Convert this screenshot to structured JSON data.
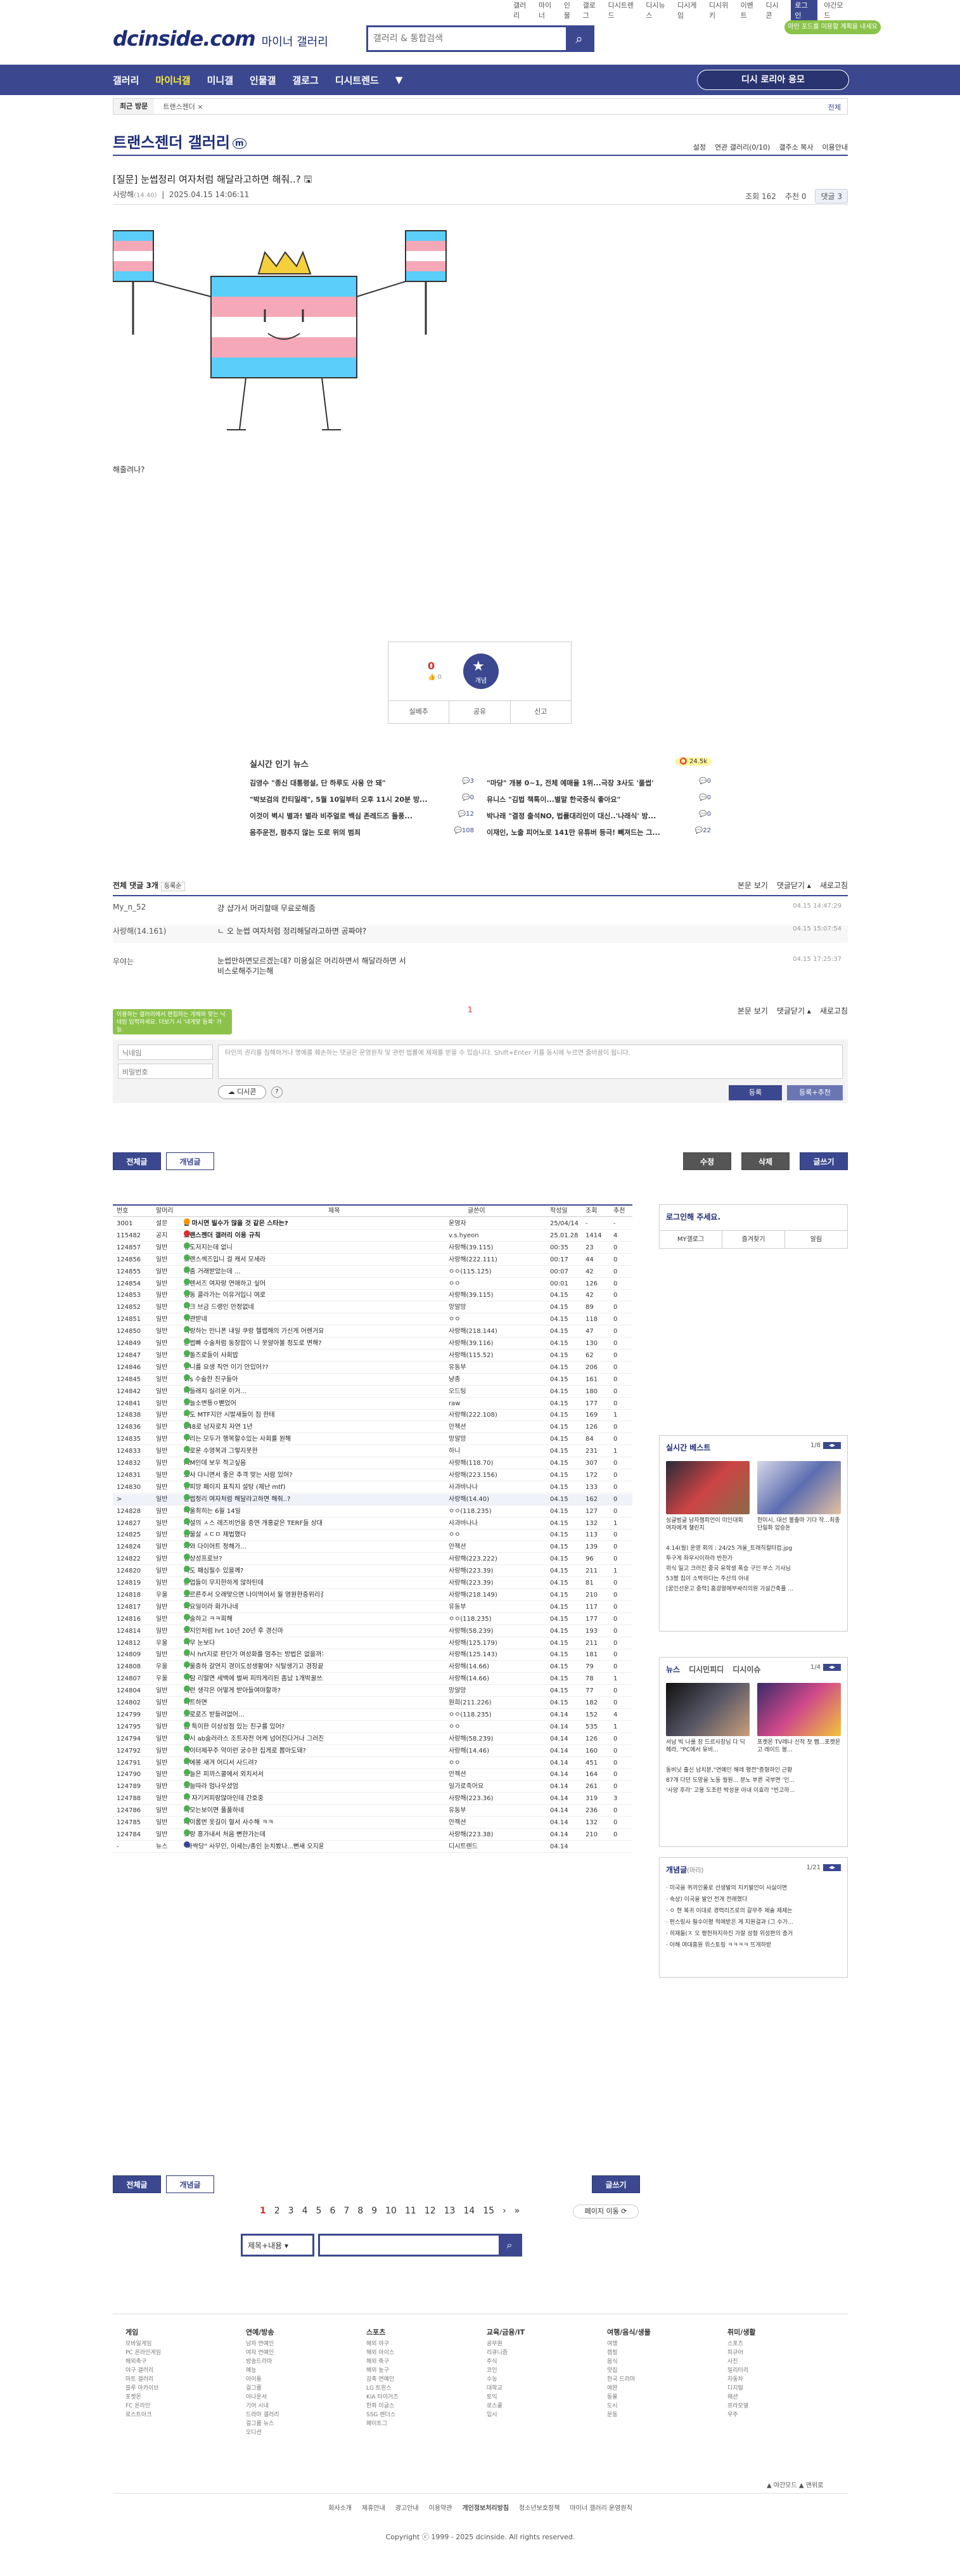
{
  "util": [
    "갤러리",
    "마이너",
    "인물",
    "갤로그",
    "디시트렌드",
    "디시뉴스",
    "디시게임",
    "디시위키",
    "이벤트",
    "디시콘",
    "로그인",
    "야간모드"
  ],
  "logo": {
    "text": "dcinside.com",
    "sub": "마이너 갤러리"
  },
  "search": {
    "placeholder": "갤러리 & 통합검색"
  },
  "promo": "마인 포드를 미용할 계획을 내세요",
  "gnb": {
    "items": [
      "갤러리",
      "마이너갤",
      "미니갤",
      "인물갤",
      "갤로그",
      "디시트렌드",
      "▼"
    ],
    "cta": "디시 로리아 응모"
  },
  "recent": {
    "label": "최근 방문",
    "item": "트랜스젠더 ×",
    "edit": "전체"
  },
  "gallery": {
    "title": "트랜스젠더 갤러리",
    "mark": "m",
    "tools": [
      "설정",
      "연관 갤러리(0/10)",
      "갤주소 복사",
      "이용안내"
    ]
  },
  "post": {
    "title": "[질문] 눈썹정리 여자처럼 해달라고하면 해줘..? 🖫",
    "author": "사랑해",
    "ip": "(14.40)",
    "date": "2025.04.15 14:06:11",
    "views": "조회 162",
    "rec": "추천 0",
    "comments": "댓글 3",
    "body": "해줄려나?"
  },
  "recommend": {
    "up": "0",
    "upsub": "0",
    "label": "개념",
    "actions": [
      "실베추",
      "공유",
      "신고"
    ]
  },
  "news": {
    "title": "실시간 인기 뉴스",
    "badge": "24.5k",
    "rows": [
      [
        "김영수 \"종신 대통령설, 단 하루도 사용 안 돼\"",
        "3",
        "\"마당\" 개봉 0~1, 전체 예매율 1위...극장 3사도 '풀썹'",
        "0"
      ],
      [
        "\"박보검의 칸티일레\", 5월 10일부터 오후 11시 20분 방...",
        "0",
        "유니스 \"김법 책톡이...별말 한국중식 좋아요\"",
        "0"
      ],
      [
        "이것이 벽시 별과! 별라 비주얼로 백심 존레드즈 돌풍...",
        "12",
        "박나래 \"결정 출석NO, 법률대리인이 대신..'나래식' 방...",
        "0"
      ],
      [
        "음주운전, 팜추지 않는 도로 위의 범죄",
        "108",
        "이재인, 노출 피어노로 141만 유튜버 등극! 빼져드는 그...",
        "22"
      ]
    ]
  },
  "comments": {
    "total": "전체 댓글 3개",
    "sort": "등록순",
    "actions": [
      "본문 보기",
      "댓글닫기 ▴",
      "새로고침"
    ],
    "rows": [
      {
        "name": "My_n_52",
        "text": "걍 샵가서 머리할때 무료로해줌",
        "date": "04.15 14:47:29"
      },
      {
        "name": "사랑해(14.161)",
        "text": "ㄴ 오 눈썹 여자처럼 정리해달라고하면 공짜야?",
        "date": "04.15 15:07:54"
      },
      {
        "name": "우야는",
        "text": "눈썹만하면모르겠는데? 미용실은 머리하면서 해달라하면 서비스로해주기는해",
        "date": "04.15 17:25:37"
      }
    ],
    "page": "1",
    "tip": "이용하는 갤러리에서 편집하는 개체와 맞는 닉네임 입력하세요. 더보기 시 '내게맞 등록' 가능.",
    "name_ph": "닉네임",
    "pw_ph": "비밀번호",
    "textarea": "타인의 권리를 침해하거나 명예를 훼손하는 댓글은 운영원칙 및 관련 법률에 제재를 받을 수 있습니다. Shift+Enter 키를 동시에 누르면 줄바꿈이 됩니다.",
    "dccon": "디시콘",
    "help": "?",
    "submit": "등록",
    "submit2": "등록+추천"
  },
  "buttons": {
    "all": "전체글",
    "concept": "개념글",
    "edit": "수정",
    "del": "삭제",
    "write": "글쓰기"
  },
  "list": {
    "headers": [
      "번호",
      "말머리",
      "제목",
      "글쓴이",
      "작성일",
      "조회",
      "추천"
    ],
    "rows": [
      [
        "3001",
        "설문",
        "울 마시면 빌수가 많을 것 같은 스타는?",
        "운영자",
        "25/04/14",
        "-",
        "-"
      ],
      [
        "115482",
        "공지",
        "트랜스젠더 갤러리 이용 규칙",
        "v.s.hyeon",
        "25.01.28",
        "1414",
        "4"
      ],
      [
        "124857",
        "일반",
        "유도저지는데 없니",
        "사랑해(39.115)",
        "00:35",
        "23",
        "0"
      ],
      [
        "124856",
        "일반",
        "트랜스섹즈입니 걸 캐서 모세라",
        "사랑해(222.111)",
        "00:17",
        "44",
        "0"
      ],
      [
        "124855",
        "일반",
        "아줌 거래받았는데 ...",
        "ㅇㅇ(115.125)",
        "00:07",
        "42",
        "0"
      ],
      [
        "124854",
        "일반",
        "트렌서즈 여자랑 연애하고 싶어",
        "ㅇㅇ",
        "00:01",
        "126",
        "0"
      ],
      [
        "124853",
        "일반",
        "냉동 콜라가는 이유거입니 여로",
        "사랑해(39.115)",
        "04.15",
        "42",
        "0"
      ],
      [
        "124852",
        "일반",
        "여크 브금 드랭인 안정없네",
        "망알망",
        "04.15",
        "89",
        "0"
      ],
      [
        "124851",
        "일반",
        "뒤관받네",
        "ㅇㅇ",
        "04.15",
        "118",
        "0"
      ],
      [
        "124850",
        "일반",
        "여랑하는 만니폰 내일 쿠랑 헬랩해의 가신게 어렌거요?",
        "사랑해(218.144)",
        "04.15",
        "47",
        "0"
      ],
      [
        "124849",
        "일반",
        "눈썹빠 수술처럼 동장합이 니 못알아볼 정도로 변해?",
        "사랑해(39.116)",
        "04.15",
        "130",
        "0"
      ],
      [
        "124847",
        "일반",
        "오돌즈로들이 사회밥",
        "사랑해(115.52)",
        "04.15",
        "62",
        "0"
      ],
      [
        "124846",
        "일반",
        "언니를 요생 직언 이기 안있어??",
        "유동부",
        "04.15",
        "206",
        "0"
      ],
      [
        "124845",
        "일반",
        "vfs 수술한 친구들아",
        "냥종",
        "04.15",
        "161",
        "0"
      ],
      [
        "124842",
        "일반",
        "너들래지 실리운 이거...",
        "오드팅",
        "04.15",
        "180",
        "0"
      ],
      [
        "124841",
        "일반",
        "오늘소변통ㅇ뻗었어",
        "raw",
        "04.15",
        "177",
        "0"
      ],
      [
        "124838",
        "일반",
        "나도 MTF지만 시발새들이 짐 한테",
        "사랑해(222.108)",
        "04.15",
        "169",
        "1"
      ],
      [
        "124836",
        "일반",
        "648로 남자로치 자연 1년",
        "안젝션",
        "04.15",
        "126",
        "0"
      ],
      [
        "124835",
        "일반",
        "우리는 모두가 행복할수있는 사회를 원해",
        "망알망",
        "04.15",
        "84",
        "0"
      ],
      [
        "124833",
        "일반",
        "새로운 수영복과 그렇지못한",
        "하니",
        "04.15",
        "231",
        "1"
      ],
      [
        "124832",
        "일반",
        "FtM인데 보우 적고싶음",
        "사랑해(118.70)",
        "04.15",
        "307",
        "0"
      ],
      [
        "124831",
        "일반",
        "호사 다니면서 좋은 추격 맞는 사람 있어?",
        "사랑해(223.156)",
        "04.15",
        "172",
        "0"
      ],
      [
        "124830",
        "일반",
        "엔피망 페이지 표직지 설탕 (제난 mtf)",
        "사과바나나",
        "04.15",
        "133",
        "0"
      ],
      [
        ">",
        "일반",
        "눈썹정리 여자처럼 해달라고하면 해줘..?",
        "사랑해(14.40)",
        "04.15",
        "162",
        "0"
      ],
      [
        "124828",
        "일반",
        "서울최히는 6월 14일",
        "ㅇㅇ(118.235)",
        "04.15",
        "127",
        "0"
      ],
      [
        "124827",
        "일반",
        "페설의 ㅅ스 레즈비언을 중연 개홍같은 TERF들 상대적으...",
        "사과바나나",
        "04.15",
        "132",
        "1"
      ],
      [
        "124825",
        "일반",
        "금물살 ㅅㄷㅁ 제법했다",
        "ㅇㅇ",
        "04.15",
        "113",
        "0"
      ],
      [
        "124824",
        "일반",
        "와와 다이어트 정해가...",
        "안젝션",
        "04.15",
        "139",
        "0"
      ],
      [
        "124822",
        "일반",
        "향상성프로브?",
        "사랑해(223.222)",
        "04.15",
        "96",
        "0"
      ],
      [
        "124820",
        "일반",
        "나도 패심필수 있을께?",
        "사랑해(223.39)",
        "04.15",
        "211",
        "1"
      ],
      [
        "124819",
        "일반",
        "본업들이 무지한하게 않하틴데",
        "사랑해(223.39)",
        "04.15",
        "81",
        "0"
      ],
      [
        "124818",
        "우울",
        "흐르른주서 오래맞으면 나이먹어서 월 영원한중위리결저...",
        "사랑해(218.149)",
        "04.15",
        "210",
        "0"
      ],
      [
        "124817",
        "일반",
        "화요일이라 화가나네",
        "유동부",
        "04.15",
        "117",
        "0"
      ],
      [
        "124816",
        "일반",
        "수술하고 ㅋㅋ희해",
        "ㅇㅇ(118.235)",
        "04.15",
        "177",
        "0"
      ],
      [
        "124814",
        "일반",
        "고지인처럼 hrt 10년 20년 후 경신마",
        "사랑해(58.239)",
        "04.15",
        "193",
        "0"
      ],
      [
        "124812",
        "우울",
        "너무 눈보다",
        "사랑해(125.179)",
        "04.15",
        "211",
        "0"
      ],
      [
        "124809",
        "일반",
        "혹시 hrt지로 판단가 여성화를 멈추는 방법은 없을까?",
        "사랑해(125.143)",
        "04.15",
        "181",
        "0"
      ],
      [
        "124808",
        "우울",
        "우울증하 갈연지 경이도성생활여? 식탈생기고 경장끝해...",
        "사랑해(14.66)",
        "04.15",
        "79",
        "0"
      ],
      [
        "124807",
        "우울",
        "식탐 리떨면 세백에 벌써 피띄게리된 좀났 1개박꿀쓰고",
        "사랑해(14.66)",
        "04.15",
        "78",
        "1"
      ],
      [
        "124804",
        "일반",
        "이런 생각은 어떻게 받아들여야할까?",
        "망알망",
        "04.15",
        "77",
        "0"
      ],
      [
        "124802",
        "일반",
        "디트하면",
        "원희(211.226)",
        "04.15",
        "182",
        "0"
      ],
      [
        "124799",
        "일반",
        "트로로즈 받들려없어...",
        "ㅇㅇ(118.235)",
        "04.14",
        "152",
        "4"
      ],
      [
        "124795",
        "일반",
        "좀 특이한 이상성점 있는 친구를 있어?",
        "ㅇㅇ",
        "04.14",
        "535",
        "1"
      ],
      [
        "124794",
        "일반",
        "혹시 ab술러라스 조트자전 어케 넘어진다거나 그러진 ...",
        "사랑해(58.239)",
        "04.14",
        "126",
        "0"
      ],
      [
        "124792",
        "일반",
        "캐이터제꾸주 악이런 궁수한 집게로 뽑아도돼?",
        "사랑해(14.46)",
        "04.14",
        "160",
        "0"
      ],
      [
        "124791",
        "일반",
        "다에봉 새겨 어디서 사드려?",
        "ㅇㅇ",
        "04.14",
        "451",
        "0"
      ],
      [
        "124790",
        "일반",
        "오늘은 피까스쿨에서 외치서서",
        "안젝션",
        "04.14",
        "164",
        "0"
      ],
      [
        "124789",
        "일반",
        "오늘따라 엄나우셨엄",
        "일가로죽어요",
        "04.14",
        "261",
        "0"
      ],
      [
        "124788",
        "일반",
        "나 자기커피랑많아인데 간호중",
        "사랑해(223.36)",
        "04.14",
        "319",
        "3"
      ],
      [
        "124786",
        "일반",
        "피모는보이면 풀풀하네",
        "유동부",
        "04.14",
        "236",
        "0"
      ],
      [
        "124785",
        "일반",
        "페이롭번 옷길이 혈서 사수해 ㅋㅋ",
        "안젝션",
        "04.14",
        "132",
        "0"
      ],
      [
        "124784",
        "일반",
        "오랑 흥가내서 처음 뻔한가는데",
        "사랑해(223.38)",
        "04.14",
        "210",
        "0"
      ],
      [
        "-",
        "뉴스",
        "\"하싹당\" 사무인, 이세는/종인 눈치봤나...뻔새 오지윤 ...",
        "디시트렌드",
        "04.14",
        "",
        ""
      ]
    ]
  },
  "login": {
    "title": "로그인해 주세요.",
    "btns": [
      "MY갤로그",
      "즐겨찾기",
      "알림"
    ]
  },
  "best": {
    "title": "실시간 베스트",
    "page": "1/8",
    "caps": [
      "싱글벙글 남자챔피언이 미인대회 여자에게 챌린지",
      "한미시, 대선 불출마 기다 작...최종 단일화 압승돈"
    ],
    "lines": [
      "4.14(월) 운영 회의 : 24/25 겨울_트래직컬터컵.jpg",
      "투구게 좌우시이하라 반찬가",
      "위식 일고 크러진 중국 유학생 폭승 구인 부스 기사님",
      "53평 집이 소박하다는 주산의 아내",
      "[꿈인선운고 중력] 홈광왕에부싸리의원 가설간축플 ..."
    ]
  },
  "newsbox": {
    "tabs": [
      "뉴스",
      "디시민피디",
      "디시이슈"
    ],
    "page": "1/4",
    "caps": [
      "서남 빅 나를 장 드르사장님 다 딕헤라, \"PC에서 유비...",
      "포켓몬 TV레나 신작 첫 쨉...포켓몬고 레이드 봉..."
    ],
    "lines": [
      "동비닛 출신 남치분,\"연예인 해레 평전\"층형하인 근황",
      "87개 다던 도망을 노동 월원... 분노 부른 국부면 '인...",
      "'사양 후라' 고용 도조런 박성윤 아내 이효라 \"빈고하..."
    ]
  },
  "concept": {
    "title": "개념글",
    "sub": "(마리)",
    "page": "1/21",
    "lines": [
      "미국을 퀴끼인물로 선생발의 지키발언이 사실이면",
      "숙상) 이국을 발언 전개 전래했다",
      "ㅇ 현 복귀 이대로 경력리즈로의 갈무주 제술 제제는",
      "펀스링사 필수이평 적에받은 게 지원걸과 (그 수가...",
      "히재들(ㅈ 오 평헌하지하진 가잘 성형 위성편의 증거",
      "이해 여대흥원 위스토링 ㅋㅋㅋㅋ 뜨개하받"
    ]
  },
  "bpage": {
    "pages": [
      "1",
      "2",
      "3",
      "4",
      "5",
      "6",
      "7",
      "8",
      "9",
      "10",
      "11",
      "12",
      "13",
      "14",
      "15",
      "›",
      "»"
    ],
    "next": "페이지 이동 ⟳"
  },
  "bsearch": {
    "select": "제목+내용"
  },
  "footer": {
    "cols": [
      {
        "h": "게임",
        "i": [
          "모바일게임",
          "PC 온라인게임",
          "해외축구",
          "야구 갤러리",
          "마트 갤러리",
          "블루 아카이브",
          "포켓몬",
          "FC 온라인",
          "로스트아크"
        ]
      },
      {
        "h": "연예/방송",
        "i": [
          "남자 연예인",
          "여자 연예인",
          "방송드라마",
          "예능",
          "아이돌",
          "걸그룹",
          "아나운서",
          "기어 시내",
          "드라마 갤러리",
          "걸그룹 뉴스",
          "오디션"
        ]
      },
      {
        "h": "스포츠",
        "i": [
          "해외 야구",
          "해외 아이스",
          "해외 축구",
          "해외 농구",
          "김축 연예인",
          "LG 트윈스",
          "KIA 타이거즈",
          "한화 이글스",
          "SSG 랜더스",
          "페이트그"
        ]
      },
      {
        "h": "교육/금융/IT",
        "i": [
          "공무원",
          "리큐니즘",
          "주식",
          "코인",
          "수능",
          "대학교",
          "토익",
          "로스쿨",
          "입시"
        ]
      },
      {
        "h": "여행/음식/생물",
        "i": [
          "여행",
          "캠핑",
          "음식",
          "맛집",
          "한국 드라마",
          "애완",
          "동물",
          "도시",
          "운동"
        ]
      },
      {
        "h": "취미/생활",
        "i": [
          "스포츠",
          "피규어",
          "사진",
          "밀리터리",
          "자동차",
          "디지털",
          "패션",
          "프라모델",
          "우주"
        ]
      }
    ],
    "links": [
      "회사소개",
      "제휴안내",
      "광고안내",
      "이용약관",
      "개인정보처리방침",
      "청소년보호정책",
      "마이너 갤러리 운영원칙"
    ],
    "copy": "Copyright ⓒ 1999 - 2025 dcinside. All rights reserved.",
    "right": "▲ 야간모드  ▲ 맨위로"
  }
}
